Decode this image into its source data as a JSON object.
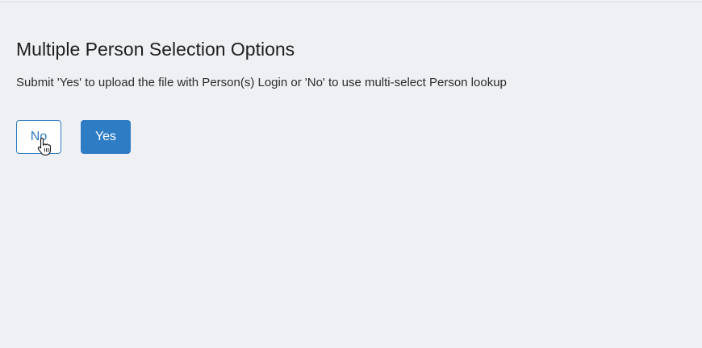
{
  "dialog": {
    "title": "Multiple Person Selection Options",
    "description": "Submit 'Yes' to upload the file with Person(s) Login or 'No' to use multi-select Person lookup",
    "no_label": "No",
    "yes_label": "Yes"
  },
  "colors": {
    "background": "#eff0f4",
    "primary": "#2e7cc4",
    "button_outline_bg": "#ffffff"
  },
  "icons": {
    "cursor": "hand-pointer-icon"
  }
}
